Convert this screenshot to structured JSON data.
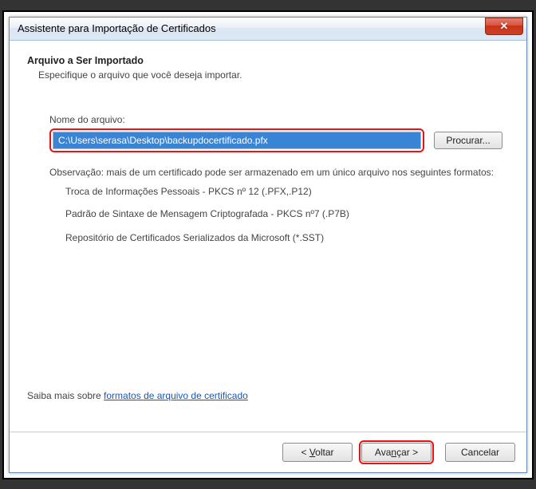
{
  "titlebar": {
    "title": "Assistente para Importação de Certificados",
    "close_glyph": "✕"
  },
  "heading": "Arquivo a Ser Importado",
  "subheading": "Especifique o arquivo que você deseja importar.",
  "file": {
    "label": "Nome do arquivo:",
    "value": "C:\\Users\\serasa\\Desktop\\backupdocertificado.pfx",
    "browse": "Procurar..."
  },
  "note": "Observação: mais de um certificado pode ser armazenado em um único arquivo nos seguintes formatos:",
  "formats": [
    "Troca de Informações Pessoais - PKCS nº 12 (.PFX,.P12)",
    "Padrão de Sintaxe de Mensagem Criptografada - PKCS nº7 (.P7B)",
    "Repositório de Certificados Serializados da Microsoft (*.SST)"
  ],
  "learn_more": {
    "prefix": "Saiba mais sobre ",
    "link_text": "formatos de arquivo de certificado"
  },
  "buttons": {
    "back_prefix": "< ",
    "back_u": "V",
    "back_rest": "oltar",
    "next_prefix": "Ava",
    "next_u": "n",
    "next_rest": "çar >",
    "cancel": "Cancelar"
  }
}
